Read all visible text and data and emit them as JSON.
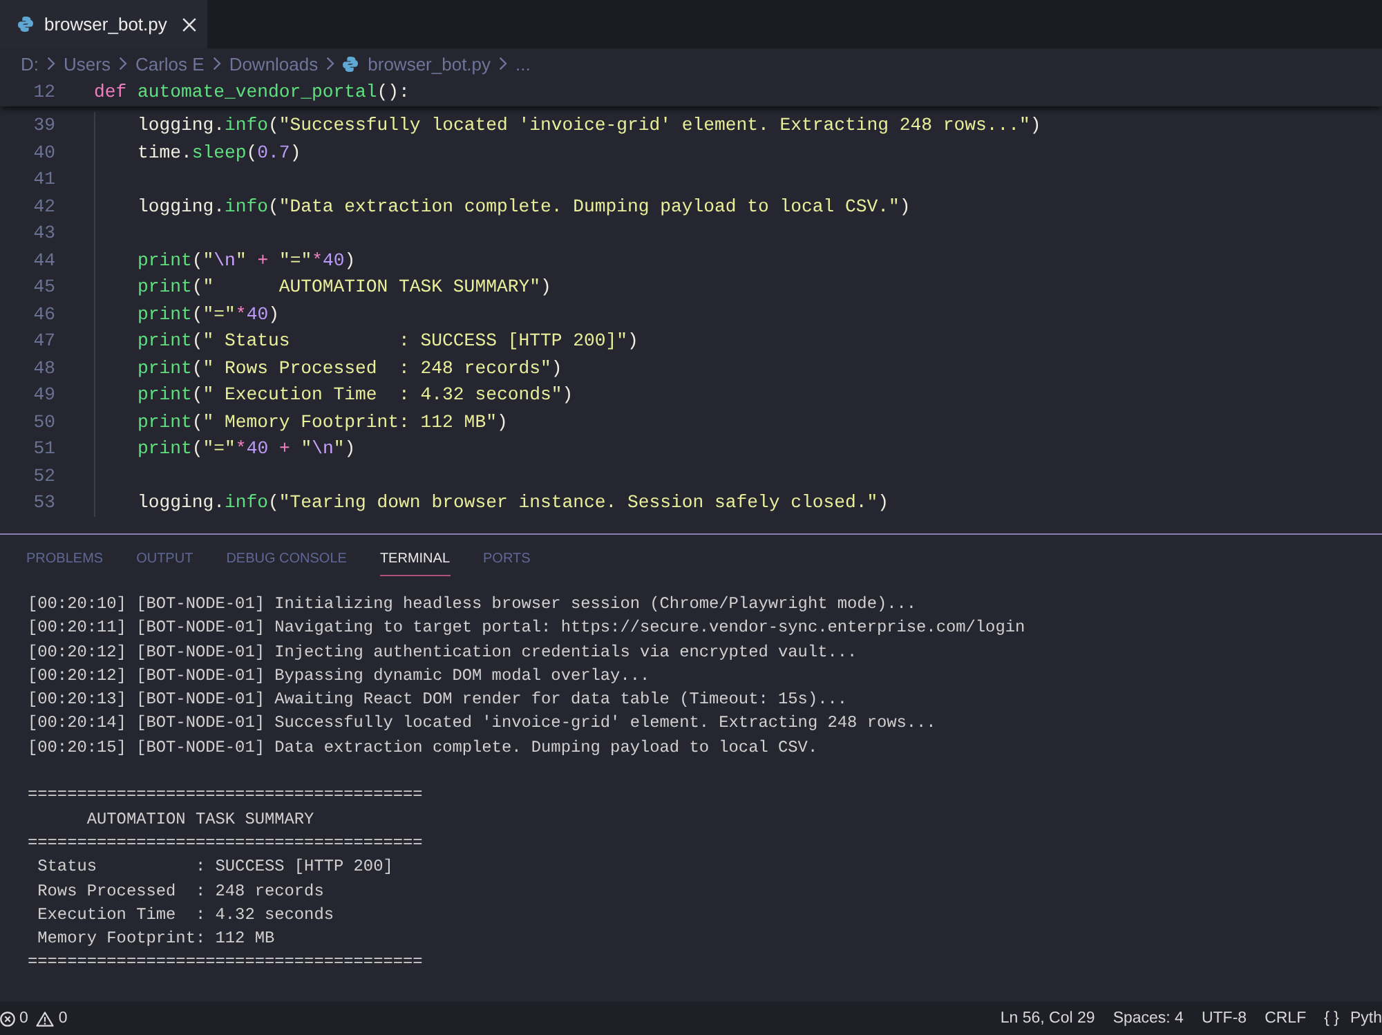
{
  "tabs": [
    {
      "label": "browser_bot.py",
      "selected": true
    }
  ],
  "breadcrumb": [
    {
      "kind": "folder",
      "label": "D:"
    },
    {
      "kind": "folder",
      "label": "Users"
    },
    {
      "kind": "folder",
      "label": "Carlos E"
    },
    {
      "kind": "folder",
      "label": "Downloads"
    },
    {
      "kind": "file",
      "label": "browser_bot.py"
    },
    {
      "kind": "more",
      "label": "..."
    }
  ],
  "editor": {
    "lines": [
      {
        "number": "12",
        "tokens": [
          {
            "kind": "keyword",
            "text": "def "
          },
          {
            "kind": "function",
            "text": "automate_vendor_portal"
          },
          {
            "kind": "plain",
            "text": "():"
          }
        ],
        "children": [
          {
            "number": "39",
            "tokens": [
              {
                "kind": "plain",
                "text": "logging."
              },
              {
                "kind": "function",
                "text": "info"
              },
              {
                "kind": "plain",
                "text": "("
              },
              {
                "kind": "string",
                "text": "\"Successfully located 'invoice-grid' element. Extracting 248 rows...\""
              },
              {
                "kind": "plain",
                "text": ")"
              }
            ]
          },
          {
            "number": "40",
            "tokens": [
              {
                "kind": "plain",
                "text": "time."
              },
              {
                "kind": "function",
                "text": "sleep"
              },
              {
                "kind": "plain",
                "text": "("
              },
              {
                "kind": "number",
                "text": "0.7"
              },
              {
                "kind": "plain",
                "text": ")"
              }
            ]
          },
          {
            "number": "41"
          },
          {
            "number": "42",
            "tokens": [
              {
                "kind": "plain",
                "text": "logging."
              },
              {
                "kind": "function",
                "text": "info"
              },
              {
                "kind": "plain",
                "text": "("
              },
              {
                "kind": "string",
                "text": "\"Data extraction complete. Dumping payload to local CSV.\""
              },
              {
                "kind": "plain",
                "text": ")"
              }
            ]
          },
          {
            "number": "43"
          },
          {
            "number": "44",
            "tokens": [
              {
                "kind": "function",
                "text": "print"
              },
              {
                "kind": "plain",
                "text": "("
              },
              {
                "kind": "string",
                "text": "\""
              },
              {
                "kind": "escape",
                "text": "\\n"
              },
              {
                "kind": "string",
                "text": "\""
              },
              {
                "kind": "operator",
                "text": " + "
              },
              {
                "kind": "string",
                "text": "\"=\""
              },
              {
                "kind": "operator",
                "text": "*"
              },
              {
                "kind": "number",
                "text": "40"
              },
              {
                "kind": "plain",
                "text": ")"
              }
            ]
          },
          {
            "number": "45",
            "tokens": [
              {
                "kind": "function",
                "text": "print"
              },
              {
                "kind": "plain",
                "text": "("
              },
              {
                "kind": "string",
                "text": "\"      AUTOMATION TASK SUMMARY\""
              },
              {
                "kind": "plain",
                "text": ")"
              }
            ]
          },
          {
            "number": "46",
            "tokens": [
              {
                "kind": "function",
                "text": "print"
              },
              {
                "kind": "plain",
                "text": "("
              },
              {
                "kind": "string",
                "text": "\"=\""
              },
              {
                "kind": "operator",
                "text": "*"
              },
              {
                "kind": "number",
                "text": "40"
              },
              {
                "kind": "plain",
                "text": ")"
              }
            ]
          },
          {
            "number": "47",
            "tokens": [
              {
                "kind": "function",
                "text": "print"
              },
              {
                "kind": "plain",
                "text": "("
              },
              {
                "kind": "string",
                "text": "\" Status          : SUCCESS [HTTP 200]\""
              },
              {
                "kind": "plain",
                "text": ")"
              }
            ]
          },
          {
            "number": "48",
            "tokens": [
              {
                "kind": "function",
                "text": "print"
              },
              {
                "kind": "plain",
                "text": "("
              },
              {
                "kind": "string",
                "text": "\" Rows Processed  : 248 records\""
              },
              {
                "kind": "plain",
                "text": ")"
              }
            ]
          },
          {
            "number": "49",
            "tokens": [
              {
                "kind": "function",
                "text": "print"
              },
              {
                "kind": "plain",
                "text": "("
              },
              {
                "kind": "string",
                "text": "\" Execution Time  : 4.32 seconds\""
              },
              {
                "kind": "plain",
                "text": ")"
              }
            ]
          },
          {
            "number": "50",
            "tokens": [
              {
                "kind": "function",
                "text": "print"
              },
              {
                "kind": "plain",
                "text": "("
              },
              {
                "kind": "string",
                "text": "\" Memory Footprint: 112 MB\""
              },
              {
                "kind": "plain",
                "text": ")"
              }
            ]
          },
          {
            "number": "51",
            "tokens": [
              {
                "kind": "function",
                "text": "print"
              },
              {
                "kind": "plain",
                "text": "("
              },
              {
                "kind": "string",
                "text": "\"=\""
              },
              {
                "kind": "operator",
                "text": "*"
              },
              {
                "kind": "number",
                "text": "40"
              },
              {
                "kind": "operator",
                "text": " + "
              },
              {
                "kind": "string",
                "text": "\""
              },
              {
                "kind": "escape",
                "text": "\\n"
              },
              {
                "kind": "string",
                "text": "\""
              },
              {
                "kind": "plain",
                "text": ")"
              }
            ]
          },
          {
            "number": "52"
          },
          {
            "number": "53",
            "tokens": [
              {
                "kind": "plain",
                "text": "logging."
              },
              {
                "kind": "function",
                "text": "info"
              },
              {
                "kind": "plain",
                "text": "("
              },
              {
                "kind": "string",
                "text": "\"Tearing down browser instance. Session safely closed.\""
              },
              {
                "kind": "plain",
                "text": ")"
              }
            ]
          }
        ]
      }
    ]
  },
  "panel": {
    "tabs": [
      {
        "label": "PROBLEMS",
        "selected": false
      },
      {
        "label": "OUTPUT",
        "selected": false
      },
      {
        "label": "DEBUG CONSOLE",
        "selected": false
      },
      {
        "label": "TERMINAL",
        "selected": true
      },
      {
        "label": "PORTS",
        "selected": false
      }
    ],
    "terminal": {
      "log_lines": [
        "[00:20:10] [BOT-NODE-01] Initializing headless browser session (Chrome/Playwright mode)...",
        "[00:20:11] [BOT-NODE-01] Navigating to target portal: https://secure.vendor-sync.enterprise.com/login",
        "[00:20:12] [BOT-NODE-01] Injecting authentication credentials via encrypted vault...",
        "[00:20:12] [BOT-NODE-01] Bypassing dynamic DOM modal overlay...",
        "[00:20:13] [BOT-NODE-01] Awaiting React DOM render for data table (Timeout: 15s)...",
        "[00:20:14] [BOT-NODE-01] Successfully located 'invoice-grid' element. Extracting 248 rows...",
        "[00:20:15] [BOT-NODE-01] Data extraction complete. Dumping payload to local CSV."
      ],
      "summary_lines": [
        "========================================",
        "      AUTOMATION TASK SUMMARY",
        "========================================",
        " Status          : SUCCESS [HTTP 200]",
        " Rows Processed  : 248 records",
        " Execution Time  : 4.32 seconds",
        " Memory Footprint: 112 MB",
        "========================================"
      ]
    }
  },
  "status_bar": {
    "errors": "0",
    "warnings": "0",
    "items": [
      "Ln 56, Col 29",
      "Spaces: 4",
      "UTF-8",
      "CRLF"
    ],
    "language": {
      "icon": "{ }",
      "label": "Pyth"
    }
  }
}
